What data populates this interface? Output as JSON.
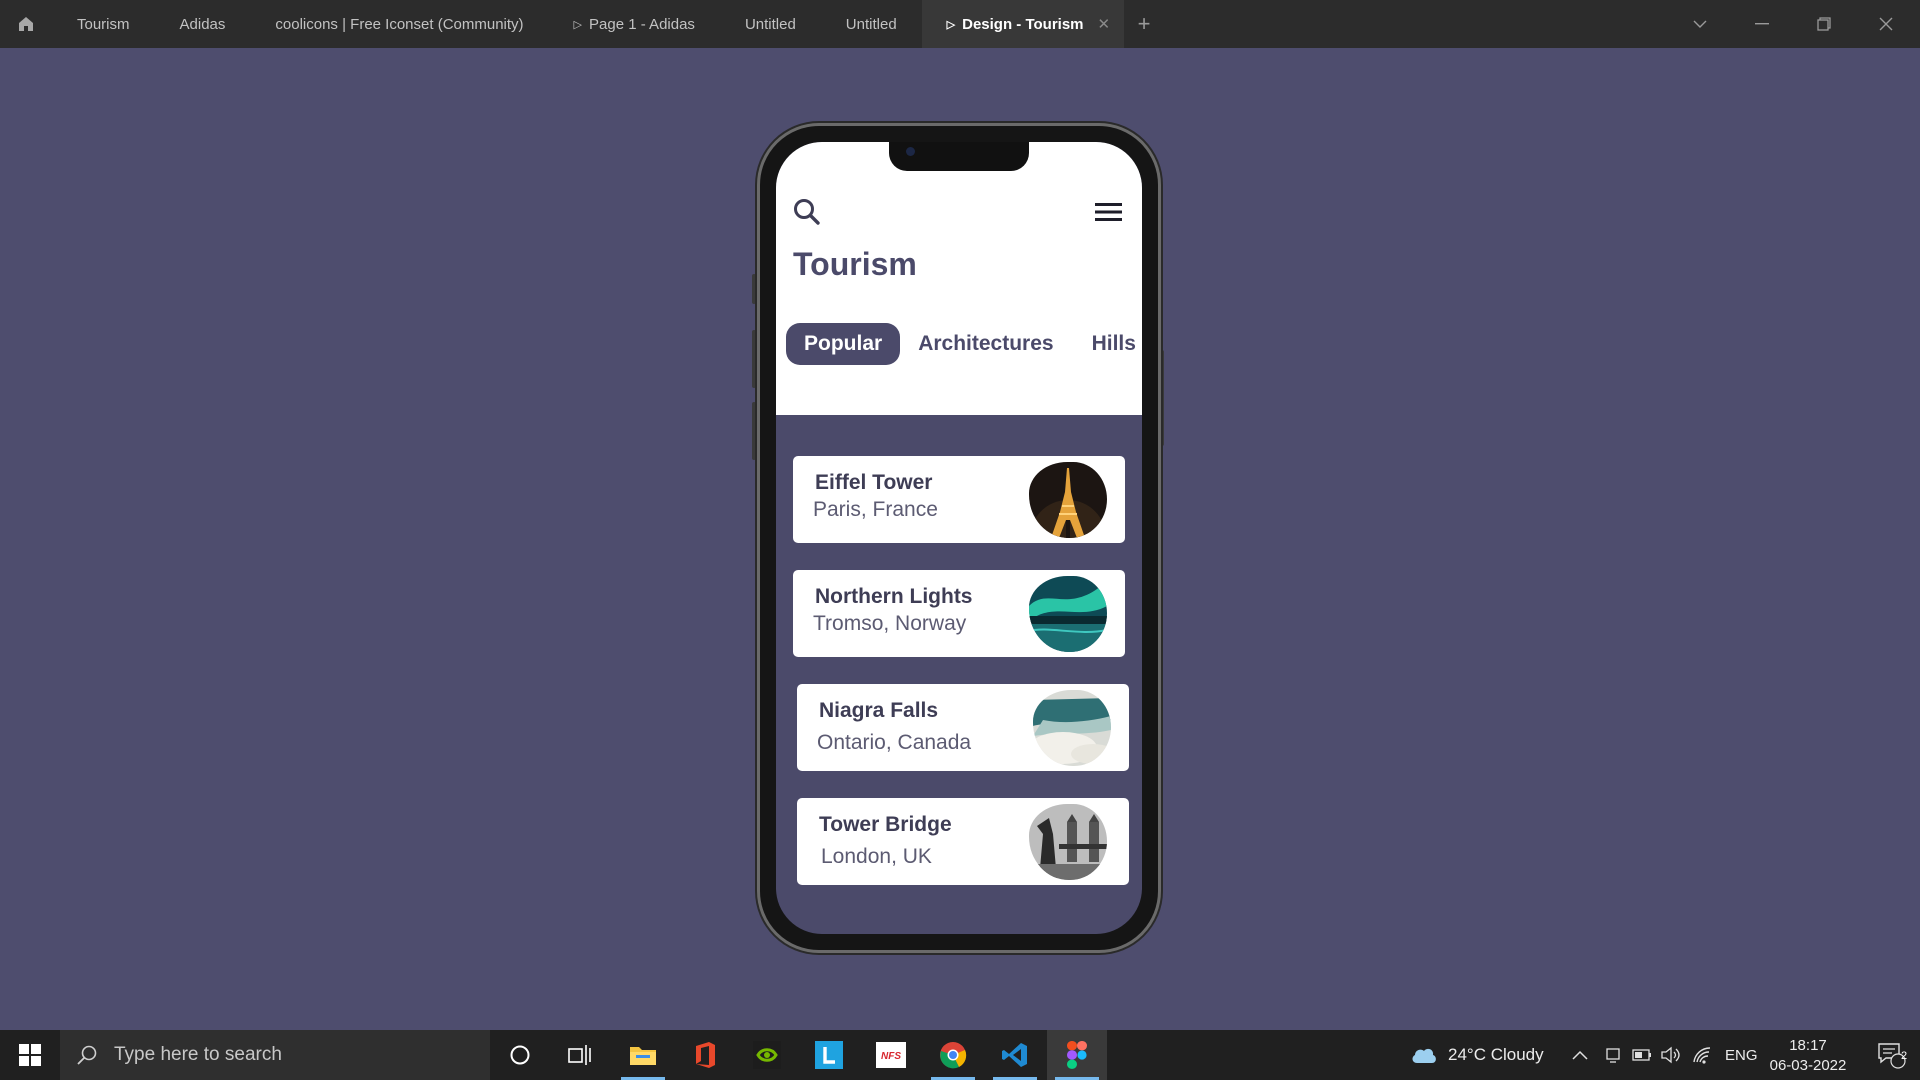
{
  "titlebar": {
    "tabs": [
      {
        "label": "Tourism",
        "has_play": false
      },
      {
        "label": "Adidas",
        "has_play": false
      },
      {
        "label": "coolicons | Free Iconset (Community)",
        "has_play": false
      },
      {
        "label": "Page 1 - Adidas",
        "has_play": true
      },
      {
        "label": "Untitled",
        "has_play": false
      },
      {
        "label": "Untitled",
        "has_play": false
      },
      {
        "label": "Design - Tourism",
        "has_play": true,
        "active": true
      }
    ],
    "icons": {
      "home": "home-icon",
      "new_tab": "plus-icon",
      "chevron": "chevron-down-icon",
      "minimize": "minimize-icon",
      "restore": "restore-icon",
      "close": "close-icon"
    }
  },
  "app": {
    "title": "Tourism",
    "icons": {
      "search": "search-icon",
      "menu": "hamburger-menu-icon"
    },
    "categories": [
      "Popular",
      "Architectures",
      "Hills"
    ],
    "active_category": "Popular",
    "places": [
      {
        "name": "Eiffel Tower",
        "location": "Paris, France",
        "image": "eiffel-tower-at-night"
      },
      {
        "name": "Northern Lights",
        "location": "Tromso, Norway",
        "image": "aurora-over-water"
      },
      {
        "name": "Niagra Falls",
        "location": "Ontario, Canada",
        "image": "waterfall-mist"
      },
      {
        "name": "Tower Bridge",
        "location": "London, UK",
        "image": "tower-bridge-bw"
      }
    ]
  },
  "taskbar": {
    "search_placeholder": "Type here to search",
    "apps": [
      "cortana-icon",
      "task-view-icon",
      "file-explorer-icon",
      "office-icon",
      "nvidia-icon",
      "l-app-icon",
      "nfs-icon",
      "chrome-icon",
      "vscode-icon",
      "figma-icon"
    ],
    "weather": "24°C  Cloudy",
    "language": "ENG",
    "time": "18:17",
    "date": "06-03-2022",
    "notification_count": "2"
  },
  "colors": {
    "accent": "#4b4a6a",
    "canvas": "#4e4d6e",
    "titlebar": "#2c2c2c",
    "taskbar": "#202020"
  }
}
